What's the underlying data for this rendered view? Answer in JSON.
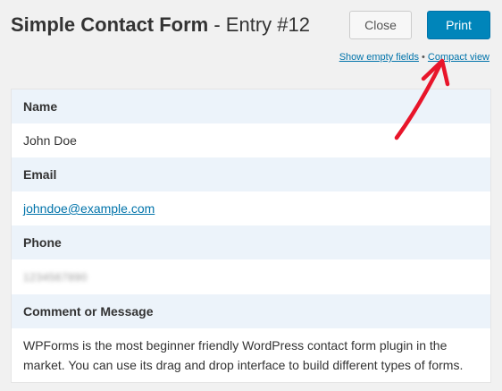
{
  "header": {
    "form_name": "Simple Contact Form",
    "entry_label": " - Entry #12",
    "close_label": "Close",
    "print_label": "Print"
  },
  "view_links": {
    "show_empty": "Show empty fields",
    "separator": " • ",
    "compact": "Compact view"
  },
  "fields": [
    {
      "label": "Name",
      "value": "John Doe"
    },
    {
      "label": "Email",
      "value": "johndoe@example.com"
    },
    {
      "label": "Phone",
      "value": "1234567890"
    },
    {
      "label": "Comment or Message",
      "value": "WPForms is the most beginner friendly WordPress contact form plugin in the market. You can use its drag and drop interface to build different types of forms."
    }
  ],
  "colors": {
    "accent": "#0085ba",
    "label_background": "#ecf3fa",
    "annotation_arrow": "#e8152a"
  }
}
